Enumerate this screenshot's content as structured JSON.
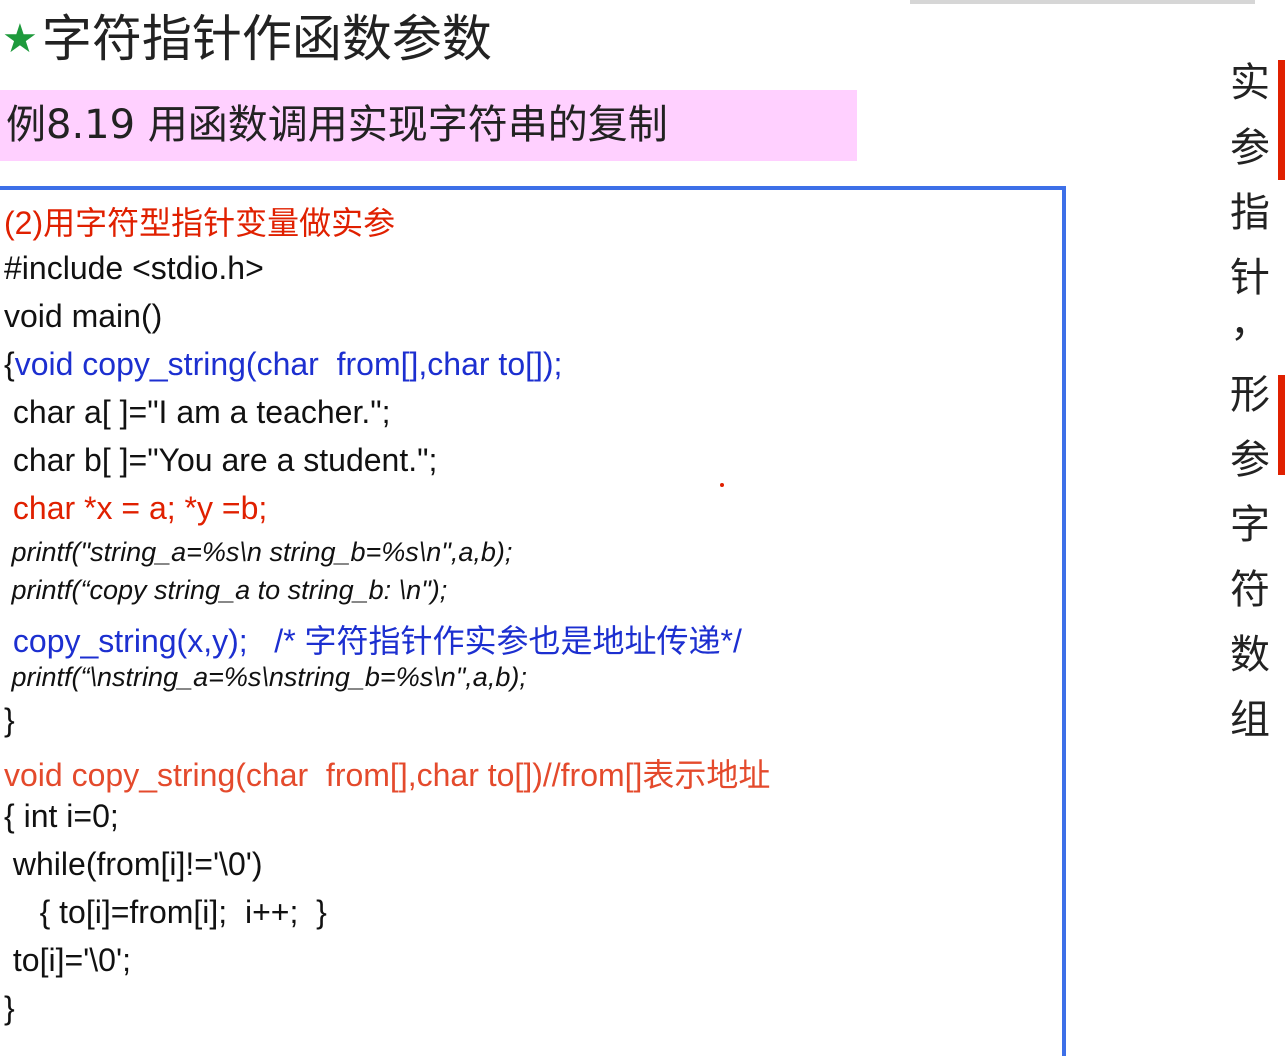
{
  "title": {
    "star": "★",
    "text": "字符指针作函数参数"
  },
  "subtitle": "例8.19   用函数调用实现字符串的复制",
  "code": {
    "heading": "(2)用字符型指针变量做实参",
    "include": "#include <stdio.h>",
    "main_sig": "void main()",
    "decl_brace": "{",
    "decl": "void copy_string(char  from[],char to[]);",
    "line_a": " char a[ ]=\"I am a teacher.\";",
    "line_b": " char b[ ]=\"You are a student.\";",
    "line_ptr": " char *x = a; *y =b;",
    "printf1": " printf(\"string_a=%s\\n string_b=%s\\n\",a,b);",
    "printf2": " printf(“copy string_a to string_b: \\n\");",
    "call": " copy_string(x,y);   /* 字符指针作实参也是地址传递*/",
    "printf3": " printf(“\\nstring_a=%s\\nstring_b=%s\\n\",a,b);",
    "close_main": "}",
    "func_sig": "void copy_string(char  from[],char to[])//from[]表示地址",
    "func_open": "{ int i=0;",
    "while": " while(from[i]!='\\0')",
    "body": "    { to[i]=from[i];  i++;  }",
    "terminate": " to[i]='\\0';",
    "close_func": "}"
  },
  "side_note": [
    "实",
    "参",
    "指",
    "针",
    "，",
    "形",
    "参",
    "字",
    "符",
    "数",
    "组"
  ]
}
